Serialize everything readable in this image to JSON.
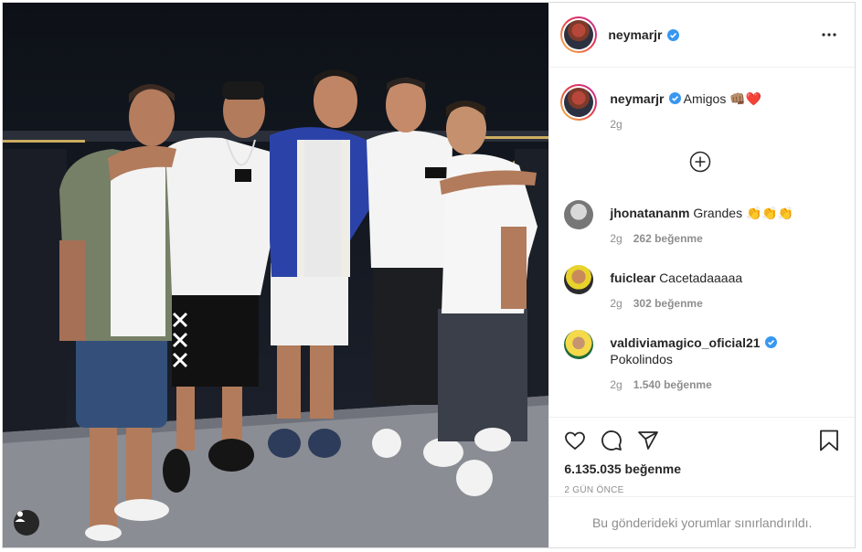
{
  "post": {
    "username": "neymarjr",
    "verified": true,
    "more_label": "More options"
  },
  "caption": {
    "username": "neymarjr",
    "text": "Amigos 👊🏽❤️",
    "time": "2g"
  },
  "load_more_label": "Load more comments",
  "comments": [
    {
      "username": "jhonatananm",
      "text": "Grandes 👏👏👏",
      "time": "2g",
      "likes": "262 beğenme",
      "verified": false
    },
    {
      "username": "fuiclear",
      "text": "Cacetadaaaaa",
      "time": "2g",
      "likes": "302 beğenme",
      "verified": false
    },
    {
      "username": "valdiviamagico_oficial21",
      "text": "Pokolindos",
      "time": "2g",
      "likes": "1.540 beğenme",
      "verified": true
    }
  ],
  "actions": {
    "like_count": "6.135.035 beğenme",
    "time_ago": "2 GÜN ÖNCE",
    "comments_restricted": "Bu gönderideki yorumlar sınırlandırıldı."
  },
  "colors": {
    "verified_blue": "#3897f0",
    "muted_text": "#8e8e8e",
    "border": "#efefef"
  },
  "icons": [
    "heart-icon",
    "comment-icon",
    "share-icon",
    "bookmark-icon",
    "more-icon",
    "add-circle-icon",
    "user-tag-icon",
    "verified-badge-icon"
  ]
}
